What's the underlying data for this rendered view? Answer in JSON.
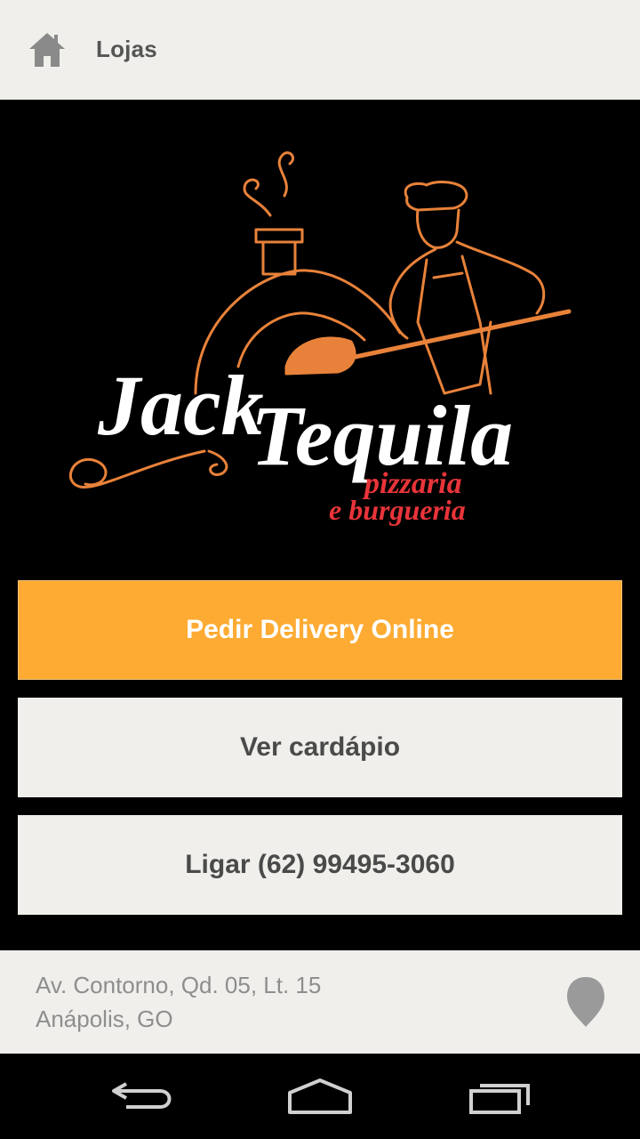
{
  "appbar": {
    "title": "Lojas",
    "icon": "home-icon"
  },
  "logo": {
    "brand_line1": "Jack",
    "brand_line2": "Tequila",
    "tagline1": "pizzaria",
    "tagline2": "e burgueria",
    "colors": {
      "white": "#ffffff",
      "orange": "#e8823a",
      "red": "#e8343a"
    }
  },
  "actions": {
    "delivery_label": "Pedir Delivery Online",
    "menu_label": "Ver cardápio",
    "call_label": "Ligar (62) 99495-3060"
  },
  "address": {
    "line1": "Av. Contorno, Qd. 05, Lt. 15",
    "line2": "Anápolis, GO",
    "icon": "map-pin-icon"
  },
  "navbar": {
    "back_icon": "back-icon",
    "home_icon": "home-nav-icon",
    "recents_icon": "recent-apps-icon"
  },
  "colors": {
    "accent": "#fdab33",
    "surface": "#f0efeb",
    "background": "#000000"
  }
}
